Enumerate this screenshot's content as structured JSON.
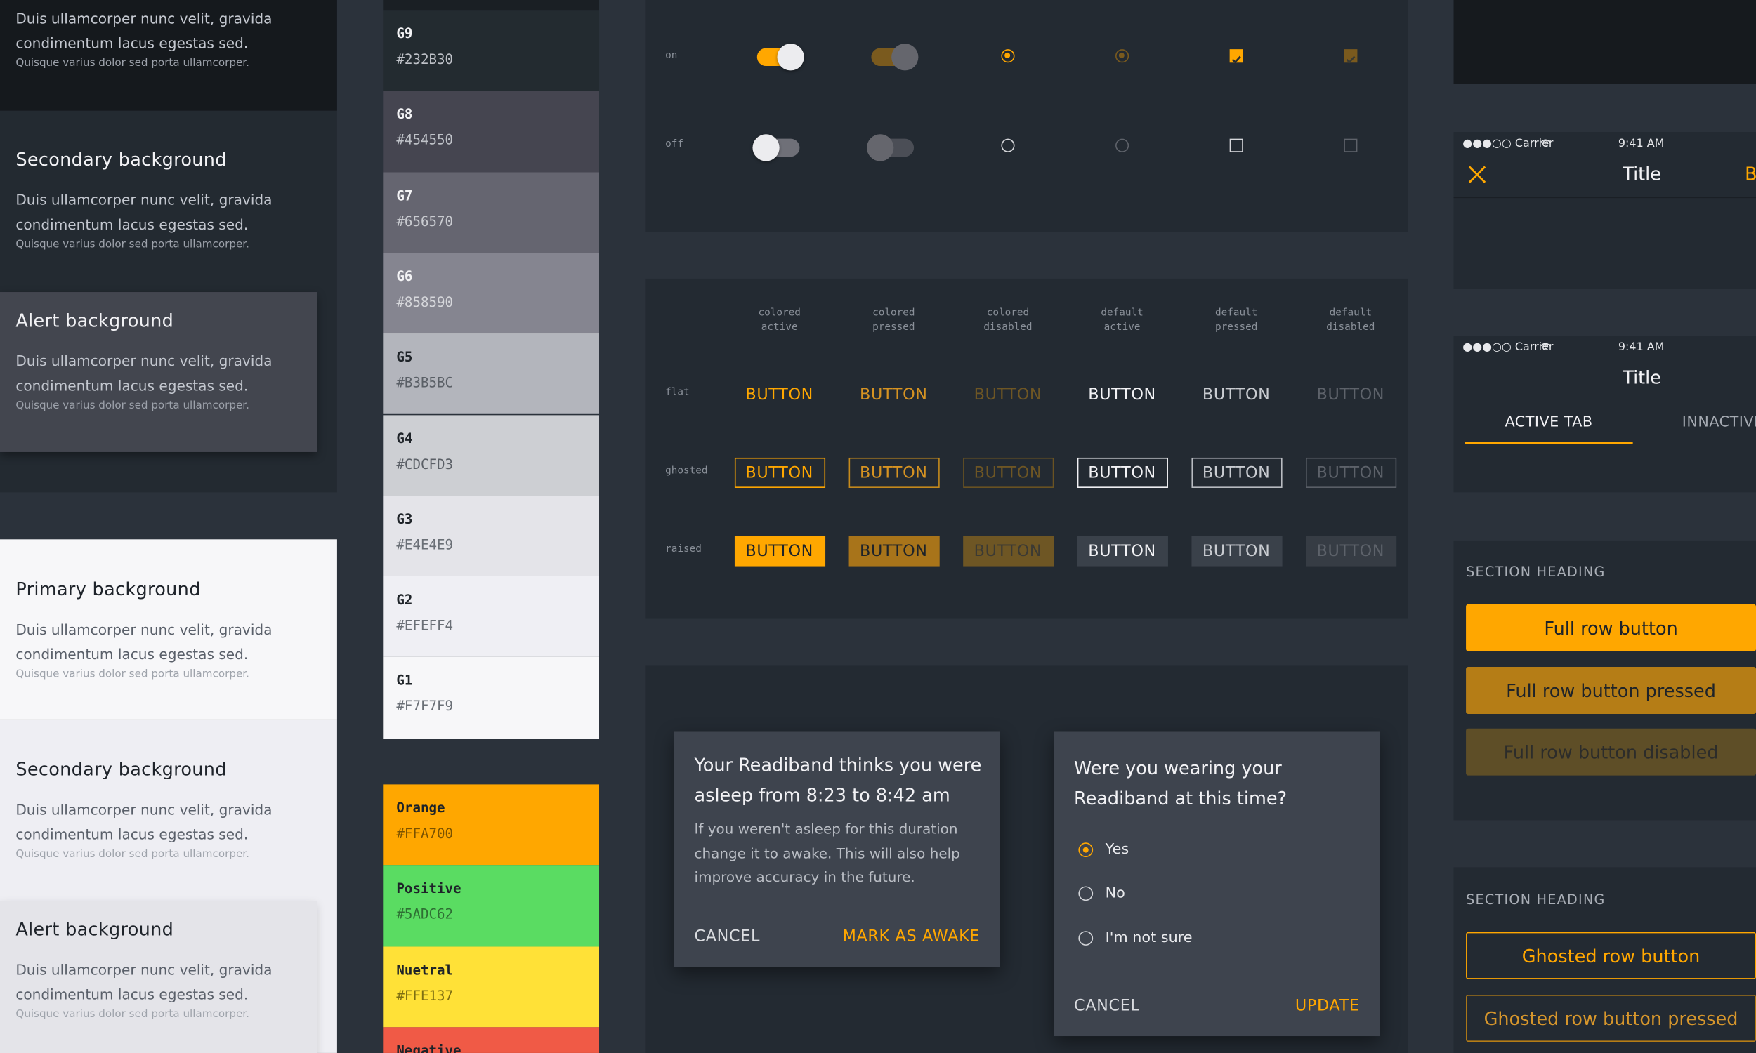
{
  "colors": {
    "orange": "#FFA700",
    "positive": "#5ADC62",
    "neutral": "#FFE137",
    "negative": "#F05A46"
  },
  "backgrounds": {
    "dark": [
      {
        "title": "",
        "text": "Duis ullamcorper nunc velit, gravida condimentum lacus egestas sed.",
        "small": "Quisque varius dolor sed porta ullamcorper."
      },
      {
        "title": "Secondary background",
        "text": "Duis ullamcorper nunc velit, gravida condimentum lacus egestas sed.",
        "small": "Quisque varius dolor sed porta ullamcorper."
      },
      {
        "title": "Alert background",
        "text": "Duis ullamcorper nunc velit, gravida condimentum lacus egestas sed.",
        "small": "Quisque varius dolor sed porta ullamcorper."
      }
    ],
    "light": [
      {
        "title": "Primary background",
        "text": "Duis ullamcorper nunc velit, gravida condimentum lacus egestas sed.",
        "small": "Quisque varius dolor sed porta ullamcorper."
      },
      {
        "title": "Secondary background",
        "text": "Duis ullamcorper nunc velit, gravida condimentum lacus egestas sed.",
        "small": "Quisque varius dolor sed porta ullamcorper."
      },
      {
        "title": "Alert background",
        "text": "Duis ullamcorper nunc velit, gravida condimentum lacus egestas sed.",
        "small": "Quisque varius dolor sed porta ullamcorper."
      }
    ]
  },
  "grays": [
    {
      "name": "G9",
      "hex": "#232B30"
    },
    {
      "name": "G8",
      "hex": "#454550"
    },
    {
      "name": "G7",
      "hex": "#656570"
    },
    {
      "name": "G6",
      "hex": "#858590"
    },
    {
      "name": "G5",
      "hex": "#B3B5BC"
    },
    {
      "name": "G4",
      "hex": "#CDCFD3"
    },
    {
      "name": "G3",
      "hex": "#E4E4E9"
    },
    {
      "name": "G2",
      "hex": "#EFEFF4"
    },
    {
      "name": "G1",
      "hex": "#F7F7F9"
    }
  ],
  "semantic": [
    {
      "name": "Orange",
      "hex": "#FFA700"
    },
    {
      "name": "Positive",
      "hex": "#5ADC62"
    },
    {
      "name": "Nuetral",
      "hex": "#FFE137"
    },
    {
      "name": "Negative",
      "hex": ""
    }
  ],
  "controls": {
    "on_label": "on",
    "off_label": "off"
  },
  "buttons": {
    "headers": [
      {
        "l1": "colored",
        "l2": "active"
      },
      {
        "l1": "colored",
        "l2": "pressed"
      },
      {
        "l1": "colored",
        "l2": "disabled"
      },
      {
        "l1": "default",
        "l2": "active"
      },
      {
        "l1": "default",
        "l2": "pressed"
      },
      {
        "l1": "default",
        "l2": "disabled"
      }
    ],
    "rows": {
      "flat": "flat",
      "ghosted": "ghosted",
      "raised": "raised"
    },
    "label": "BUTTON"
  },
  "dialog1": {
    "title": "Your Readiband thinks you were asleep from 8:23 to 8:42 am",
    "body": "If you weren't asleep for this duration change it to awake. This will also help improve accuracy in the future.",
    "cancel": "CANCEL",
    "confirm": "MARK AS AWAKE"
  },
  "dialog2": {
    "title": "Were you wearing your Readiband at this time?",
    "options": [
      "Yes",
      "No",
      "I'm not sure"
    ],
    "cancel": "CANCEL",
    "confirm": "UPDATE"
  },
  "phone1": {
    "carrier": "●●●○○ Carrier",
    "time": "9:41 AM",
    "title": "Title",
    "right": "B"
  },
  "phone2": {
    "carrier": "●●●○○ Carrier",
    "time": "9:41 AM",
    "title": "Title",
    "tab_active": "ACTIVE TAB",
    "tab_inactive": "INNACTIVE"
  },
  "section1": {
    "heading": "SECTION HEADING",
    "btn1": "Full row button",
    "btn2": "Full row button pressed",
    "btn3": "Full row button disabled"
  },
  "section2": {
    "heading": "SECTION HEADING",
    "btn1": "Ghosted row button",
    "btn2": "Ghosted row button pressed"
  }
}
